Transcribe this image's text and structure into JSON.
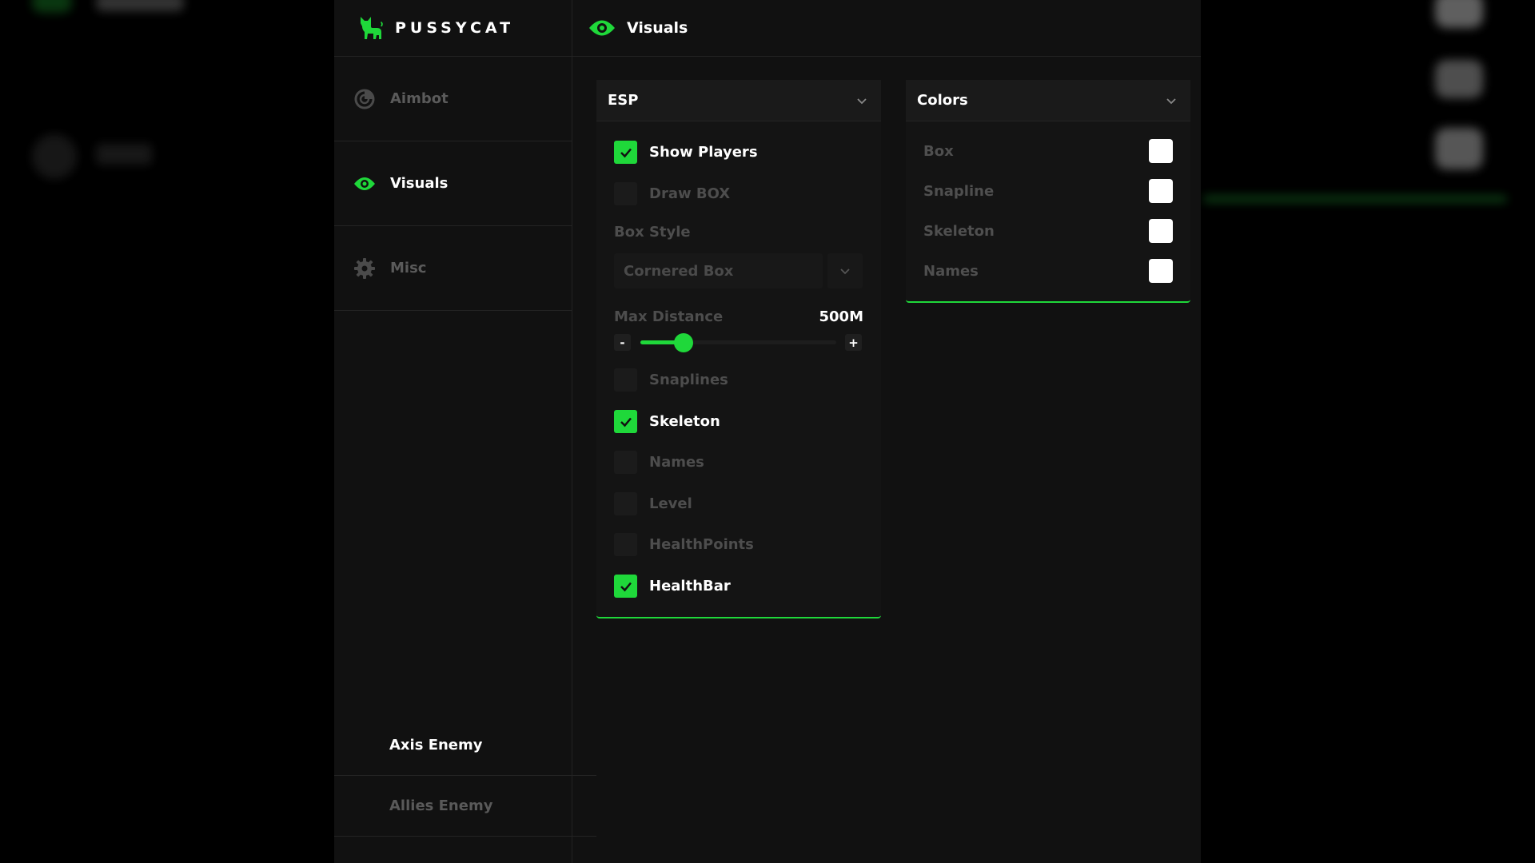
{
  "brand": {
    "name": "PUSSYCAT",
    "logo_icon": "cat-icon"
  },
  "colors": {
    "accent": "#1fd83a",
    "background": "#111111",
    "panel": "#141414",
    "dim_text": "#4d4d4d"
  },
  "sidebar": {
    "items": [
      {
        "label": "Aimbot",
        "icon": "target-icon",
        "active": false
      },
      {
        "label": "Visuals",
        "icon": "eye-icon",
        "active": true
      },
      {
        "label": "Misc",
        "icon": "gear-icon",
        "active": false
      }
    ],
    "teams": [
      {
        "label": "Axis Enemy",
        "active": true
      },
      {
        "label": "Allies Enemy",
        "active": false
      }
    ]
  },
  "header": {
    "title": "Visuals",
    "icon": "eye-icon"
  },
  "esp": {
    "title": "ESP",
    "show_players": {
      "label": "Show Players",
      "checked": true
    },
    "draw_box": {
      "label": "Draw BOX",
      "checked": false
    },
    "box_style": {
      "label": "Box Style",
      "value": "Cornered Box"
    },
    "max_distance": {
      "label": "Max Distance",
      "value_text": "500M",
      "level": 0.22,
      "minus": "-",
      "plus": "+"
    },
    "snaplines": {
      "label": "Snaplines",
      "checked": false
    },
    "skeleton": {
      "label": "Skeleton",
      "checked": true
    },
    "names": {
      "label": "Names",
      "checked": false
    },
    "level": {
      "label": "Level",
      "checked": false
    },
    "healthpoints": {
      "label": "HealthPoints",
      "checked": false
    },
    "healthbar": {
      "label": "HealthBar",
      "checked": true
    }
  },
  "colors_panel": {
    "title": "Colors",
    "items": [
      {
        "label": "Box",
        "color": "#ffffff"
      },
      {
        "label": "Snapline",
        "color": "#ffffff"
      },
      {
        "label": "Skeleton",
        "color": "#ffffff"
      },
      {
        "label": "Names",
        "color": "#ffffff"
      }
    ]
  }
}
